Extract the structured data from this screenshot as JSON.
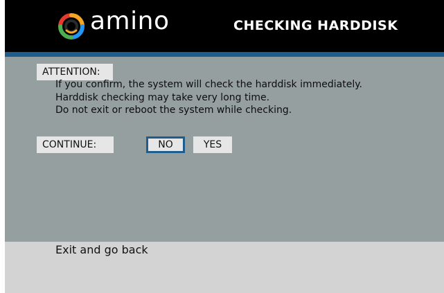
{
  "header": {
    "brand": "amino",
    "title": "CHECKING HARDDISK"
  },
  "main": {
    "attention_label": "ATTENTION:",
    "message_lines": [
      "If you confirm, the system will check the harddisk immediately.",
      "Harddisk checking may take very long time.",
      "Do not exit or reboot the system while checking."
    ],
    "continue_label": "CONTINUE:",
    "buttons": {
      "no_label": "NO",
      "yes_label": "YES",
      "selected": "NO"
    }
  },
  "footer": {
    "hint": "Exit and go back"
  },
  "colors": {
    "header_bg": "#000000",
    "accent": "#1f5e8c",
    "panel_bg": "#959fa0",
    "footer_bg": "#d3d3d3",
    "logo_ring": [
      "#e23b2e",
      "#f5a623",
      "#4caf50",
      "#2196f3"
    ]
  },
  "icons": {
    "logo": "amino-logo-icon"
  }
}
